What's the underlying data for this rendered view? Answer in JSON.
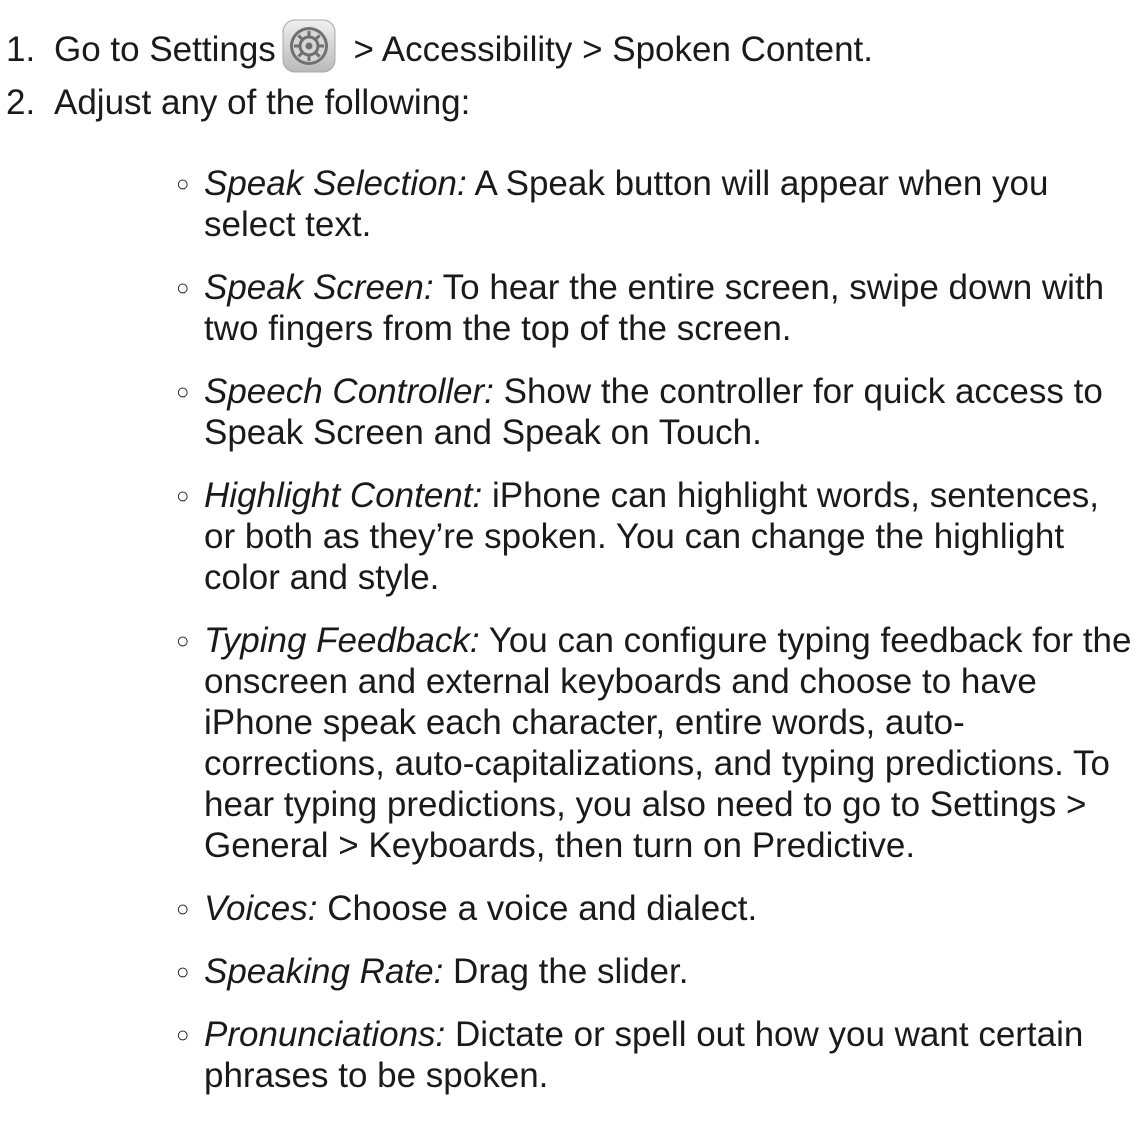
{
  "step1": {
    "number": "1.",
    "before_icon": "Go to Settings",
    "icon": "settings-gear-icon",
    "after_icon": " > Accessibility > Spoken Content."
  },
  "step2": {
    "number": "2.",
    "text": "Adjust any of the following:"
  },
  "bullet_glyph": "○",
  "items": [
    {
      "term": "Speak Selection:",
      "desc": " A Speak button will appear when you select text."
    },
    {
      "term": "Speak Screen:",
      "desc": " To hear the entire screen, swipe down with two fingers from the top of the screen."
    },
    {
      "term": "Speech Controller:",
      "desc": " Show the controller for quick access to Speak Screen and Speak on Touch."
    },
    {
      "term": "Highlight Content:",
      "desc": " iPhone can highlight words, sentences, or both as they’re spoken. You can change the highlight color and style."
    },
    {
      "term": "Typing Feedback:",
      "desc": " You can configure typing feedback for the onscreen and external keyboards and choose to have iPhone speak each character, entire words, auto-corrections, auto-capitalizations, and typing predictions. To hear typing predictions, you also need to go to Settings > General > Keyboards, then turn on Predictive."
    },
    {
      "term": "Voices:",
      "desc": " Choose a voice and dialect."
    },
    {
      "term": "Speaking Rate:",
      "desc": " Drag the slider."
    },
    {
      "term": "Pronunciations:",
      "desc": " Dictate or spell out how you want certain phrases to be spoken."
    }
  ]
}
